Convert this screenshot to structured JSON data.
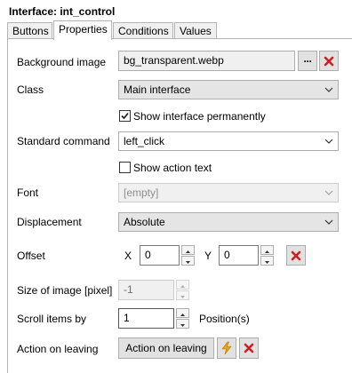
{
  "window": {
    "title": "Interface: int_control"
  },
  "tabs": [
    {
      "label": "Buttons"
    },
    {
      "label": "Properties"
    },
    {
      "label": "Conditions"
    },
    {
      "label": "Values"
    }
  ],
  "properties": {
    "background_image": {
      "label": "Background image",
      "value": "bg_transparent.webp",
      "browse_label": "···"
    },
    "class": {
      "label": "Class",
      "value": "Main interface"
    },
    "show_permanently": {
      "label": "Show interface permanently",
      "checked": true
    },
    "standard_command": {
      "label": "Standard command",
      "value": "left_click"
    },
    "show_action_text": {
      "label": "Show action text",
      "checked": false
    },
    "font": {
      "label": "Font",
      "value": "[empty]"
    },
    "displacement": {
      "label": "Displacement",
      "value": "Absolute"
    },
    "offset": {
      "label": "Offset",
      "x_label": "X",
      "x_value": "0",
      "y_label": "Y",
      "y_value": "0"
    },
    "image_size": {
      "label": "Size of image [pixel]",
      "value": "-1"
    },
    "scroll_items": {
      "label": "Scroll items by",
      "value": "1",
      "unit": "Position(s)"
    },
    "action_on_leaving": {
      "label": "Action on leaving",
      "button_label": "Action on leaving"
    }
  },
  "colors": {
    "delete_red": "#cc1f1f",
    "lightning": "#e8a317",
    "check": "#1a1a1a"
  }
}
